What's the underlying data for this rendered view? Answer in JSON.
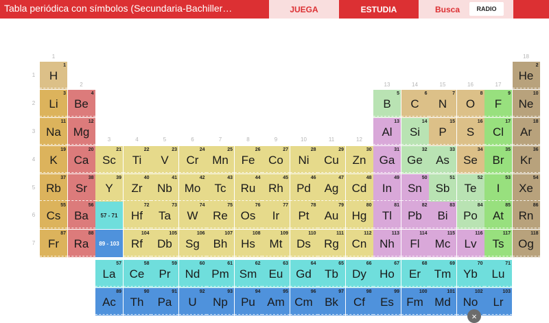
{
  "app": {
    "title": "Tabla periódica con símbolos (Secundaria-Bachiller…"
  },
  "nav": {
    "juega": "JUEGA",
    "estudia": "ESTUDIA",
    "busca": "Busca",
    "mode": "RADIO"
  },
  "colors": {
    "alkali": "#dcb35c",
    "alkaline_earth": "#dc7b7b",
    "transition": "#e6da8b",
    "post_transition": "#d9a8d9",
    "metalloid": "#b9e3b3",
    "nonmetal": "#dcc088",
    "halogen": "#98e07e",
    "noble_gas": "#b8a27c",
    "lanthanide": "#6fdedc",
    "actinide": "#4f92dc",
    "unknown": "#e6da8b"
  },
  "groups": [
    "1",
    "2",
    "3",
    "4",
    "5",
    "6",
    "7",
    "8",
    "9",
    "10",
    "11",
    "12",
    "13",
    "14",
    "15",
    "16",
    "17",
    "18"
  ],
  "periods": [
    "1",
    "2",
    "3",
    "4",
    "5",
    "6",
    "7"
  ],
  "placeholders": {
    "lanthanides": "57 - 71",
    "actinides": "89 - 103"
  },
  "elements": [
    {
      "n": "1",
      "s": "H",
      "c": "nonmetal"
    },
    {
      "n": "2",
      "s": "He",
      "c": "noble_gas"
    },
    {
      "n": "3",
      "s": "Li",
      "c": "alkali"
    },
    {
      "n": "4",
      "s": "Be",
      "c": "alkaline_earth"
    },
    {
      "n": "5",
      "s": "B",
      "c": "metalloid"
    },
    {
      "n": "6",
      "s": "C",
      "c": "nonmetal"
    },
    {
      "n": "7",
      "s": "N",
      "c": "nonmetal"
    },
    {
      "n": "8",
      "s": "O",
      "c": "nonmetal"
    },
    {
      "n": "9",
      "s": "F",
      "c": "halogen"
    },
    {
      "n": "10",
      "s": "Ne",
      "c": "noble_gas"
    },
    {
      "n": "11",
      "s": "Na",
      "c": "alkali"
    },
    {
      "n": "12",
      "s": "Mg",
      "c": "alkaline_earth"
    },
    {
      "n": "13",
      "s": "Al",
      "c": "post_transition"
    },
    {
      "n": "14",
      "s": "Si",
      "c": "metalloid"
    },
    {
      "n": "15",
      "s": "P",
      "c": "nonmetal"
    },
    {
      "n": "16",
      "s": "S",
      "c": "nonmetal"
    },
    {
      "n": "17",
      "s": "Cl",
      "c": "halogen"
    },
    {
      "n": "18",
      "s": "Ar",
      "c": "noble_gas"
    },
    {
      "n": "19",
      "s": "K",
      "c": "alkali"
    },
    {
      "n": "20",
      "s": "Ca",
      "c": "alkaline_earth"
    },
    {
      "n": "21",
      "s": "Sc",
      "c": "transition"
    },
    {
      "n": "22",
      "s": "Ti",
      "c": "transition"
    },
    {
      "n": "23",
      "s": "V",
      "c": "transition"
    },
    {
      "n": "24",
      "s": "Cr",
      "c": "transition"
    },
    {
      "n": "25",
      "s": "Mn",
      "c": "transition"
    },
    {
      "n": "26",
      "s": "Fe",
      "c": "transition"
    },
    {
      "n": "27",
      "s": "Co",
      "c": "transition"
    },
    {
      "n": "28",
      "s": "Ni",
      "c": "transition"
    },
    {
      "n": "29",
      "s": "Cu",
      "c": "transition"
    },
    {
      "n": "30",
      "s": "Zn",
      "c": "transition"
    },
    {
      "n": "31",
      "s": "Ga",
      "c": "post_transition"
    },
    {
      "n": "32",
      "s": "Ge",
      "c": "metalloid"
    },
    {
      "n": "33",
      "s": "As",
      "c": "metalloid"
    },
    {
      "n": "34",
      "s": "Se",
      "c": "nonmetal"
    },
    {
      "n": "35",
      "s": "Br",
      "c": "halogen"
    },
    {
      "n": "36",
      "s": "Kr",
      "c": "noble_gas"
    },
    {
      "n": "37",
      "s": "Rb",
      "c": "alkali"
    },
    {
      "n": "38",
      "s": "Sr",
      "c": "alkaline_earth"
    },
    {
      "n": "39",
      "s": "Y",
      "c": "transition"
    },
    {
      "n": "40",
      "s": "Zr",
      "c": "transition"
    },
    {
      "n": "41",
      "s": "Nb",
      "c": "transition"
    },
    {
      "n": "42",
      "s": "Mo",
      "c": "transition"
    },
    {
      "n": "43",
      "s": "Tc",
      "c": "transition"
    },
    {
      "n": "44",
      "s": "Ru",
      "c": "transition"
    },
    {
      "n": "45",
      "s": "Rh",
      "c": "transition"
    },
    {
      "n": "46",
      "s": "Pd",
      "c": "transition"
    },
    {
      "n": "47",
      "s": "Ag",
      "c": "transition"
    },
    {
      "n": "48",
      "s": "Cd",
      "c": "transition"
    },
    {
      "n": "49",
      "s": "In",
      "c": "post_transition"
    },
    {
      "n": "50",
      "s": "Sn",
      "c": "post_transition"
    },
    {
      "n": "51",
      "s": "Sb",
      "c": "metalloid"
    },
    {
      "n": "52",
      "s": "Te",
      "c": "metalloid"
    },
    {
      "n": "53",
      "s": "I",
      "c": "halogen"
    },
    {
      "n": "54",
      "s": "Xe",
      "c": "noble_gas"
    },
    {
      "n": "55",
      "s": "Cs",
      "c": "alkali"
    },
    {
      "n": "56",
      "s": "Ba",
      "c": "alkaline_earth"
    },
    {
      "n": "72",
      "s": "Hf",
      "c": "transition"
    },
    {
      "n": "73",
      "s": "Ta",
      "c": "transition"
    },
    {
      "n": "74",
      "s": "W",
      "c": "transition"
    },
    {
      "n": "75",
      "s": "Re",
      "c": "transition"
    },
    {
      "n": "76",
      "s": "Os",
      "c": "transition"
    },
    {
      "n": "77",
      "s": "Ir",
      "c": "transition"
    },
    {
      "n": "78",
      "s": "Pt",
      "c": "transition"
    },
    {
      "n": "79",
      "s": "Au",
      "c": "transition"
    },
    {
      "n": "80",
      "s": "Hg",
      "c": "transition"
    },
    {
      "n": "81",
      "s": "Tl",
      "c": "post_transition"
    },
    {
      "n": "82",
      "s": "Pb",
      "c": "post_transition"
    },
    {
      "n": "83",
      "s": "Bi",
      "c": "post_transition"
    },
    {
      "n": "84",
      "s": "Po",
      "c": "metalloid"
    },
    {
      "n": "85",
      "s": "At",
      "c": "halogen"
    },
    {
      "n": "86",
      "s": "Rn",
      "c": "noble_gas"
    },
    {
      "n": "87",
      "s": "Fr",
      "c": "alkali"
    },
    {
      "n": "88",
      "s": "Ra",
      "c": "alkaline_earth"
    },
    {
      "n": "104",
      "s": "Rf",
      "c": "transition"
    },
    {
      "n": "105",
      "s": "Db",
      "c": "transition"
    },
    {
      "n": "106",
      "s": "Sg",
      "c": "transition"
    },
    {
      "n": "107",
      "s": "Bh",
      "c": "transition"
    },
    {
      "n": "108",
      "s": "Hs",
      "c": "transition"
    },
    {
      "n": "109",
      "s": "Mt",
      "c": "transition"
    },
    {
      "n": "110",
      "s": "Ds",
      "c": "transition"
    },
    {
      "n": "111",
      "s": "Rg",
      "c": "transition"
    },
    {
      "n": "112",
      "s": "Cn",
      "c": "transition"
    },
    {
      "n": "113",
      "s": "Nh",
      "c": "post_transition"
    },
    {
      "n": "114",
      "s": "Fl",
      "c": "post_transition"
    },
    {
      "n": "115",
      "s": "Mc",
      "c": "post_transition"
    },
    {
      "n": "116",
      "s": "Lv",
      "c": "post_transition"
    },
    {
      "n": "117",
      "s": "Ts",
      "c": "halogen"
    },
    {
      "n": "118",
      "s": "Og",
      "c": "noble_gas"
    },
    {
      "n": "57",
      "s": "La",
      "c": "lanthanide"
    },
    {
      "n": "58",
      "s": "Ce",
      "c": "lanthanide"
    },
    {
      "n": "59",
      "s": "Pr",
      "c": "lanthanide"
    },
    {
      "n": "60",
      "s": "Nd",
      "c": "lanthanide"
    },
    {
      "n": "61",
      "s": "Pm",
      "c": "lanthanide"
    },
    {
      "n": "62",
      "s": "Sm",
      "c": "lanthanide"
    },
    {
      "n": "63",
      "s": "Eu",
      "c": "lanthanide"
    },
    {
      "n": "64",
      "s": "Gd",
      "c": "lanthanide"
    },
    {
      "n": "65",
      "s": "Tb",
      "c": "lanthanide"
    },
    {
      "n": "66",
      "s": "Dy",
      "c": "lanthanide"
    },
    {
      "n": "67",
      "s": "Ho",
      "c": "lanthanide"
    },
    {
      "n": "68",
      "s": "Er",
      "c": "lanthanide"
    },
    {
      "n": "69",
      "s": "Tm",
      "c": "lanthanide"
    },
    {
      "n": "70",
      "s": "Yb",
      "c": "lanthanide"
    },
    {
      "n": "71",
      "s": "Lu",
      "c": "lanthanide"
    },
    {
      "n": "89",
      "s": "Ac",
      "c": "actinide"
    },
    {
      "n": "90",
      "s": "Th",
      "c": "actinide"
    },
    {
      "n": "91",
      "s": "Pa",
      "c": "actinide"
    },
    {
      "n": "92",
      "s": "U",
      "c": "actinide"
    },
    {
      "n": "93",
      "s": "Np",
      "c": "actinide"
    },
    {
      "n": "94",
      "s": "Pu",
      "c": "actinide"
    },
    {
      "n": "95",
      "s": "Am",
      "c": "actinide"
    },
    {
      "n": "96",
      "s": "Cm",
      "c": "actinide"
    },
    {
      "n": "97",
      "s": "Bk",
      "c": "actinide"
    },
    {
      "n": "98",
      "s": "Cf",
      "c": "actinide"
    },
    {
      "n": "99",
      "s": "Es",
      "c": "actinide"
    },
    {
      "n": "100",
      "s": "Fm",
      "c": "actinide"
    },
    {
      "n": "101",
      "s": "Md",
      "c": "actinide"
    },
    {
      "n": "102",
      "s": "No",
      "c": "actinide"
    },
    {
      "n": "103",
      "s": "Lr",
      "c": "actinide"
    }
  ],
  "close": {
    "icon": "close-icon",
    "glyph": "×"
  }
}
